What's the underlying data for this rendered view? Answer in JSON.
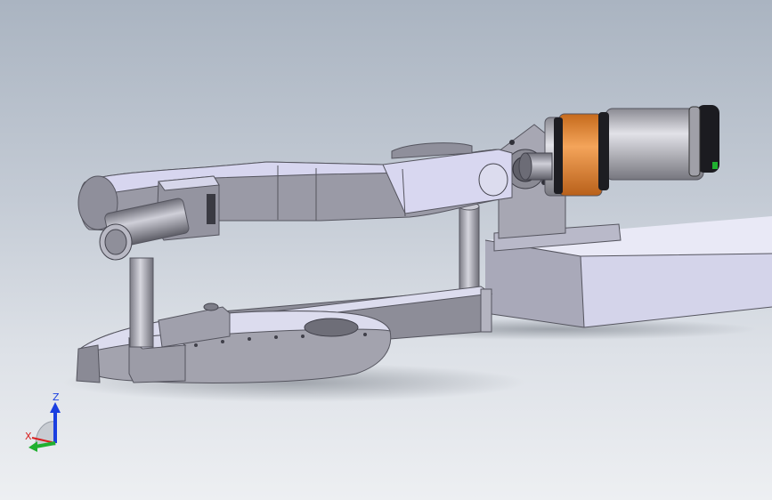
{
  "viewport": {
    "background_top": "#aab4c1",
    "background_bottom": "#edeff2"
  },
  "model": {
    "colors": {
      "linkage": "#a6a6b2",
      "linkage_light": "#d9d8f0",
      "base_block": "#d8d8ec",
      "motor_body": "#c7c7cf",
      "motor_band": "#ee9a4a",
      "motor_cap": "#202020",
      "shadow": "#8a8f98"
    }
  },
  "triad": {
    "z_label": "Z",
    "x_label": "X",
    "icons": [
      "z-axis-arrow-icon",
      "x-axis-arrow-icon",
      "y-axis-arrow-icon"
    ],
    "colors": {
      "z": "#1a3fe0",
      "x": "#d82020",
      "y": "#20b030"
    }
  }
}
